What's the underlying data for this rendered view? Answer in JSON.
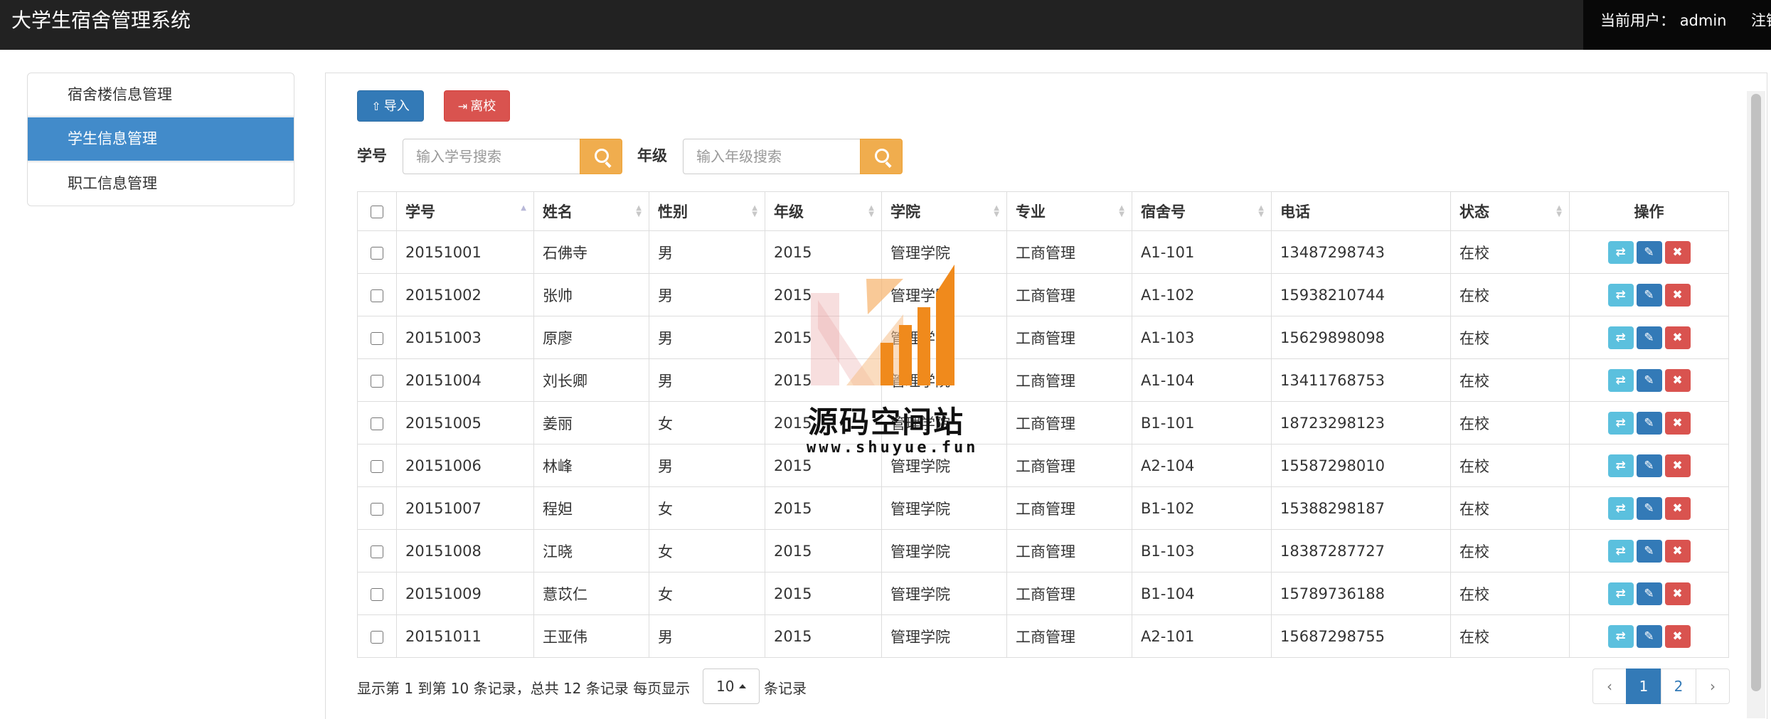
{
  "app": {
    "title": "大学生宿舍管理系统",
    "current_user_label": "当前用户：",
    "current_user": "admin",
    "logout_label": "注销"
  },
  "sidebar": {
    "items": [
      {
        "label": "宿舍楼信息管理",
        "active": false
      },
      {
        "label": "学生信息管理",
        "active": true
      },
      {
        "label": "职工信息管理",
        "active": false
      }
    ]
  },
  "toolbar": {
    "import_label": "导入",
    "import_icon": "upload-icon",
    "leave_label": "离校",
    "leave_icon": "sign-out-icon"
  },
  "search": {
    "id_label": "学号",
    "id_placeholder": "输入学号搜索",
    "id_value": "",
    "grade_label": "年级",
    "grade_placeholder": "输入年级搜索",
    "grade_value": "",
    "button_icon": "search-icon"
  },
  "table": {
    "columns": [
      "学号",
      "姓名",
      "性别",
      "年级",
      "学院",
      "专业",
      "宿舍号",
      "电话",
      "状态",
      "操作"
    ],
    "sorted_column": "学号",
    "sort_direction": "asc",
    "rows": [
      {
        "id": "20151001",
        "name": "石佛寺",
        "gender": "男",
        "grade": "2015",
        "college": "管理学院",
        "major": "工商管理",
        "dorm": "A1-101",
        "phone": "13487298743",
        "status": "在校"
      },
      {
        "id": "20151002",
        "name": "张帅",
        "gender": "男",
        "grade": "2015",
        "college": "管理学院",
        "major": "工商管理",
        "dorm": "A1-102",
        "phone": "15938210744",
        "status": "在校"
      },
      {
        "id": "20151003",
        "name": "原廖",
        "gender": "男",
        "grade": "2015",
        "college": "管理学院",
        "major": "工商管理",
        "dorm": "A1-103",
        "phone": "15629898098",
        "status": "在校"
      },
      {
        "id": "20151004",
        "name": "刘长卿",
        "gender": "男",
        "grade": "2015",
        "college": "管理学院",
        "major": "工商管理",
        "dorm": "A1-104",
        "phone": "13411768753",
        "status": "在校"
      },
      {
        "id": "20151005",
        "name": "姜丽",
        "gender": "女",
        "grade": "2015",
        "college": "管理学院",
        "major": "工商管理",
        "dorm": "B1-101",
        "phone": "18723298123",
        "status": "在校"
      },
      {
        "id": "20151006",
        "name": "林峰",
        "gender": "男",
        "grade": "2015",
        "college": "管理学院",
        "major": "工商管理",
        "dorm": "A2-104",
        "phone": "15587298010",
        "status": "在校"
      },
      {
        "id": "20151007",
        "name": "程妲",
        "gender": "女",
        "grade": "2015",
        "college": "管理学院",
        "major": "工商管理",
        "dorm": "B1-102",
        "phone": "15388298187",
        "status": "在校"
      },
      {
        "id": "20151008",
        "name": "江晓",
        "gender": "女",
        "grade": "2015",
        "college": "管理学院",
        "major": "工商管理",
        "dorm": "B1-103",
        "phone": "18387287727",
        "status": "在校"
      },
      {
        "id": "20151009",
        "name": "薏苡仁",
        "gender": "女",
        "grade": "2015",
        "college": "管理学院",
        "major": "工商管理",
        "dorm": "B1-104",
        "phone": "15789736188",
        "status": "在校"
      },
      {
        "id": "20151011",
        "name": "王亚伟",
        "gender": "男",
        "grade": "2015",
        "college": "管理学院",
        "major": "工商管理",
        "dorm": "A2-101",
        "phone": "15687298755",
        "status": "在校"
      }
    ],
    "row_actions": [
      {
        "icon": "retweet-icon",
        "color": "#5bc0de"
      },
      {
        "icon": "pencil-icon",
        "color": "#337ab7"
      },
      {
        "icon": "remove-icon",
        "color": "#d9534f"
      }
    ]
  },
  "pagination": {
    "summary": "显示第 1 到第 10 条记录，总共 12 条记录 每页显示",
    "page_size": "10",
    "suffix": "条记录",
    "prev": "‹",
    "pages": [
      "1",
      "2"
    ],
    "current_page": "1",
    "next": "›"
  },
  "watermark": {
    "text": "源码空间站",
    "url": "www.shuyue.fun"
  },
  "colors": {
    "navbar": "#222222",
    "primary": "#337ab7",
    "sidebar_active": "#428bca",
    "danger": "#d9534f",
    "warning": "#f0ad4e",
    "info": "#5bc0de"
  }
}
